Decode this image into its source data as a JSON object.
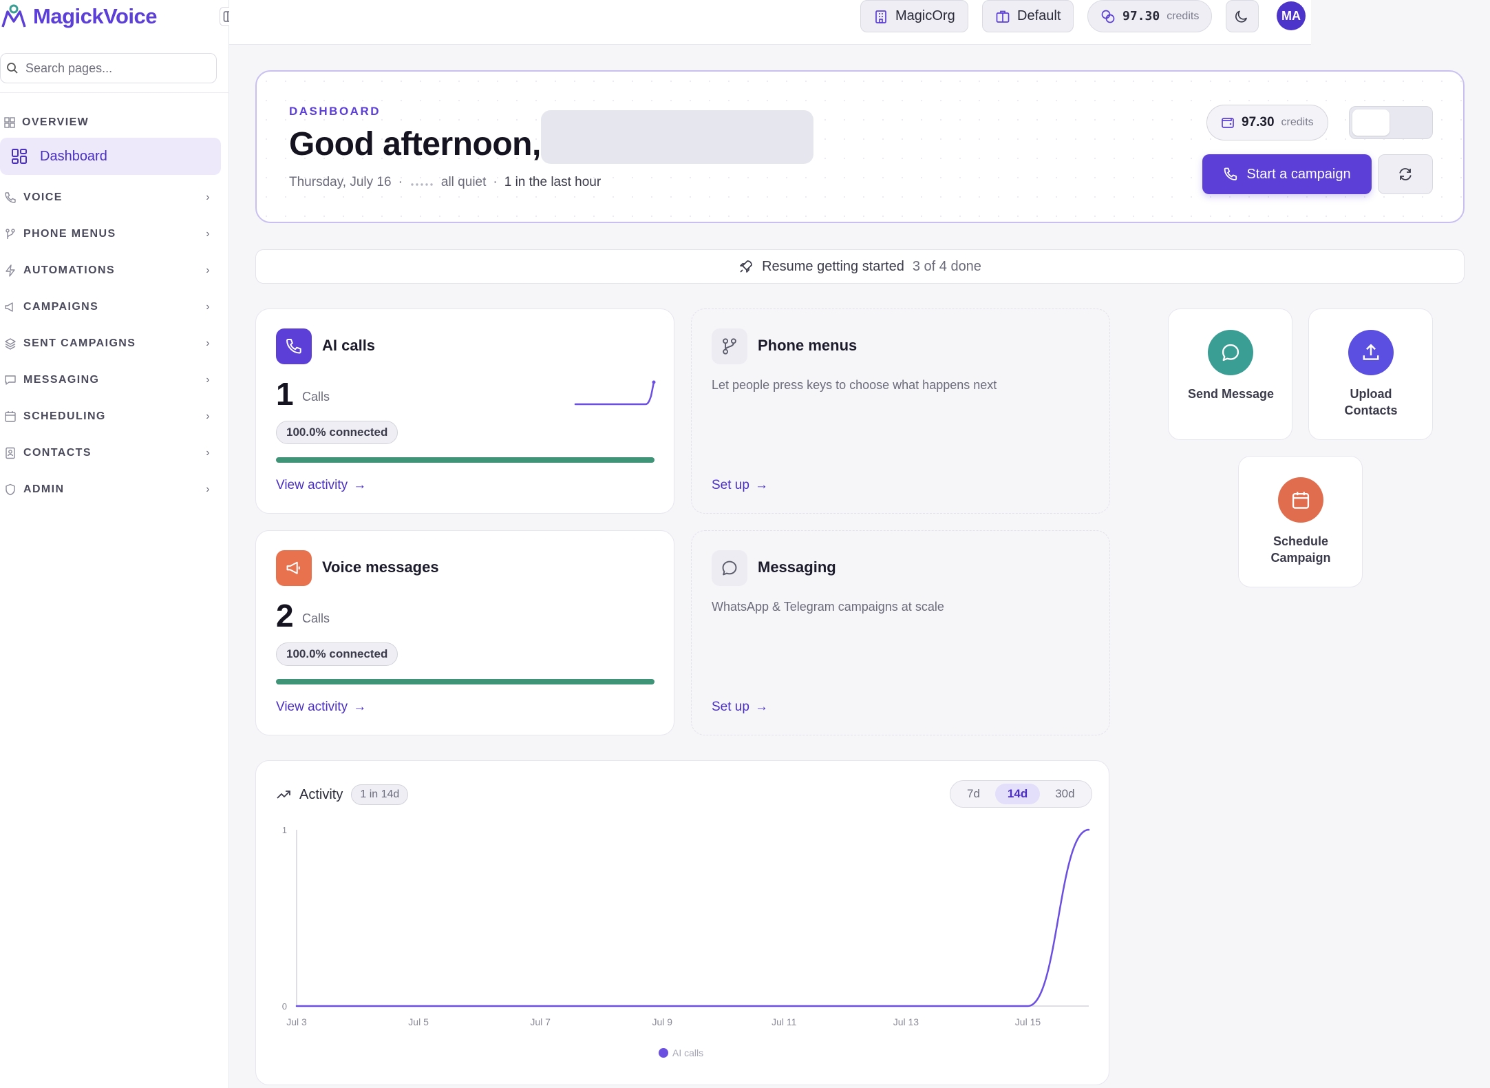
{
  "brand": {
    "name": "MagickVoice"
  },
  "sidebar": {
    "search_placeholder": "Search pages...",
    "overview_label": "OVERVIEW",
    "active_item": "Dashboard",
    "sections": [
      {
        "label": "VOICE",
        "icon": "phone-icon"
      },
      {
        "label": "PHONE MENUS",
        "icon": "branch-icon"
      },
      {
        "label": "AUTOMATIONS",
        "icon": "lightning-icon"
      },
      {
        "label": "CAMPAIGNS",
        "icon": "megaphone-icon"
      },
      {
        "label": "SENT CAMPAIGNS",
        "icon": "layers-icon"
      },
      {
        "label": "MESSAGING",
        "icon": "message-icon"
      },
      {
        "label": "SCHEDULING",
        "icon": "calendar-icon"
      },
      {
        "label": "CONTACTS",
        "icon": "contact-book-icon"
      },
      {
        "label": "ADMIN",
        "icon": "shield-icon"
      }
    ]
  },
  "topbar": {
    "org": "MagicOrg",
    "workspace": "Default",
    "credits_value": "97.30",
    "credits_label": "credits",
    "avatar_initials": "MA"
  },
  "hero": {
    "eyebrow": "DASHBOARD",
    "greeting": "Good afternoon,",
    "date": "Thursday, July 16",
    "status": "all quiet",
    "recent": "1 in the last hour",
    "credits_value": "97.30",
    "credits_label": "credits",
    "start_campaign": "Start a campaign"
  },
  "resume": {
    "label": "Resume getting started",
    "progress": "3 of 4 done"
  },
  "cards": {
    "ai_calls": {
      "title": "AI calls",
      "count": "1",
      "unit": "Calls",
      "badge": "100.0% connected",
      "progress": 1.0,
      "link": "View activity"
    },
    "phone_menus": {
      "title": "Phone menus",
      "desc": "Let people press keys to choose what happens next",
      "link": "Set up"
    },
    "voice_messages": {
      "title": "Voice messages",
      "count": "2",
      "unit": "Calls",
      "badge": "100.0% connected",
      "progress": 1.0,
      "link": "View activity"
    },
    "messaging": {
      "title": "Messaging",
      "desc": "WhatsApp & Telegram campaigns at scale",
      "link": "Set up"
    }
  },
  "quick_actions": {
    "send_message": "Send Message",
    "upload_contacts": "Upload Contacts",
    "schedule_campaign": "Schedule Campaign"
  },
  "activity": {
    "title": "Activity",
    "badge": "1 in 14d",
    "ranges": [
      "7d",
      "14d",
      "30d"
    ],
    "active_range": "14d"
  },
  "colors": {
    "accent": "#5b3fd6",
    "progress": "#3f9478",
    "voice_icon_bg": "#e8714e",
    "send_message_bg": "#3a9e94",
    "upload_bg": "#5a4fe0",
    "schedule_bg": "#e06e4e"
  },
  "chart_data": {
    "type": "line",
    "title": "",
    "xlabel": "",
    "ylabel": "",
    "x": [
      "Jul 3",
      "Jul 4",
      "Jul 5",
      "Jul 6",
      "Jul 7",
      "Jul 8",
      "Jul 9",
      "Jul 10",
      "Jul 11",
      "Jul 12",
      "Jul 13",
      "Jul 14",
      "Jul 15",
      "Jul 16"
    ],
    "x_tick_labels": [
      "Jul 3",
      "Jul 5",
      "Jul 7",
      "Jul 9",
      "Jul 11",
      "Jul 13",
      "Jul 15"
    ],
    "y_ticks": [
      "0",
      "1"
    ],
    "ylim": [
      0,
      1
    ],
    "grid": false,
    "legend_position": "bottom",
    "series": [
      {
        "name": "AI calls",
        "color": "#6b4fe0",
        "values": [
          0,
          0,
          0,
          0,
          0,
          0,
          0,
          0,
          0,
          0,
          0,
          0,
          0,
          1
        ]
      }
    ]
  }
}
